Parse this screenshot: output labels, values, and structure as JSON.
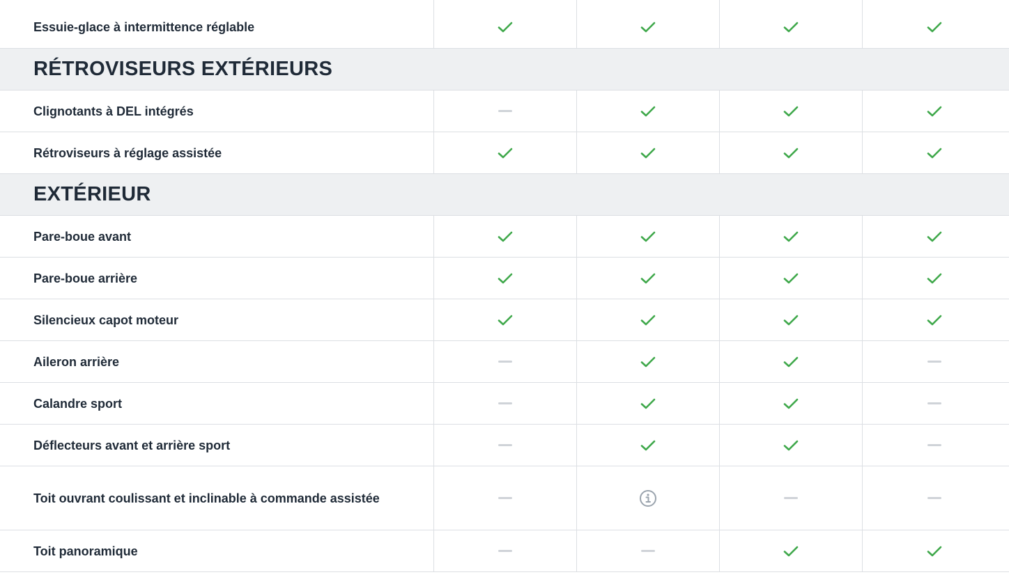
{
  "colors": {
    "check": "#3fa84b",
    "dash": "#cfd3d8",
    "info": "#9aa3ad",
    "section_bg": "#eef0f2",
    "border": "#dcdfe3"
  },
  "rows": [
    {
      "type": "feature",
      "label": "Essuie-glace à intermittence réglable",
      "values": [
        "check",
        "check",
        "check",
        "check"
      ]
    },
    {
      "type": "section",
      "title": "RÉTROVISEURS EXTÉRIEURS"
    },
    {
      "type": "feature",
      "label": "Clignotants à DEL intégrés",
      "values": [
        "dash",
        "check",
        "check",
        "check"
      ]
    },
    {
      "type": "feature",
      "label": "Rétroviseurs à réglage assistée",
      "values": [
        "check",
        "check",
        "check",
        "check"
      ]
    },
    {
      "type": "section",
      "title": "EXTÉRIEUR"
    },
    {
      "type": "feature",
      "label": "Pare-boue avant",
      "values": [
        "check",
        "check",
        "check",
        "check"
      ]
    },
    {
      "type": "feature",
      "label": "Pare-boue arrière",
      "values": [
        "check",
        "check",
        "check",
        "check"
      ]
    },
    {
      "type": "feature",
      "label": "Silencieux capot moteur",
      "values": [
        "check",
        "check",
        "check",
        "check"
      ]
    },
    {
      "type": "feature",
      "label": "Aileron arrière",
      "values": [
        "dash",
        "check",
        "check",
        "dash"
      ]
    },
    {
      "type": "feature",
      "label": "Calandre sport",
      "values": [
        "dash",
        "check",
        "check",
        "dash"
      ]
    },
    {
      "type": "feature",
      "label": "Déflecteurs avant et arrière sport",
      "values": [
        "dash",
        "check",
        "check",
        "dash"
      ]
    },
    {
      "type": "feature",
      "label": "Toit ouvrant coulissant et inclinable à commande assistée",
      "values": [
        "dash",
        "info",
        "dash",
        "dash"
      ]
    },
    {
      "type": "feature",
      "label": "Toit panoramique",
      "values": [
        "dash",
        "dash",
        "check",
        "check"
      ]
    }
  ]
}
